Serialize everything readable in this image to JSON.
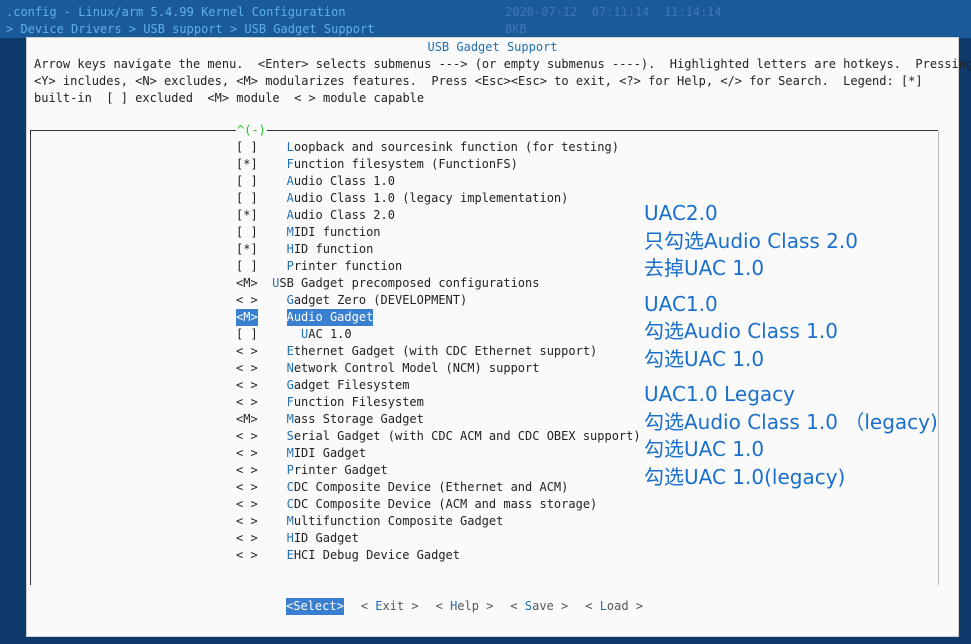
{
  "window": {
    "title_line": ".config - Linux/arm 5.4.99 Kernel Configuration",
    "breadcrumb": "> Device Drivers > USB support > USB Gadget Support",
    "ghost_line1": "2020-07-12  07:11:14  11:14:14",
    "ghost_line2": "8KB"
  },
  "dialog": {
    "title": "USB Gadget Support",
    "help_lines": [
      "Arrow keys navigate the menu.  <Enter> selects submenus ---> (or empty submenus ----).  Highlighted letters are hotkeys.  Pressing",
      "<Y> includes, <N> excludes, <M> modularizes features.  Press <Esc><Esc> to exit, <?> for Help, </> for Search.  Legend: [*]",
      "built-in  [ ] excluded  <M> module  < > module capable"
    ],
    "scroll_indicator": "^(-)"
  },
  "menu": {
    "items": [
      {
        "sel": "[ ]",
        "pad": "    ",
        "hk": "L",
        "rest": "oopback and sourcesink function (for testing)",
        "highlight": false
      },
      {
        "sel": "[*]",
        "pad": "    ",
        "hk": "F",
        "rest": "unction filesystem (FunctionFS)",
        "highlight": false
      },
      {
        "sel": "[ ]",
        "pad": "    ",
        "hk": "A",
        "rest": "udio Class 1.0",
        "highlight": false
      },
      {
        "sel": "[ ]",
        "pad": "    ",
        "hk": "A",
        "rest": "udio Class 1.0 (legacy implementation)",
        "highlight": false
      },
      {
        "sel": "[*]",
        "pad": "    ",
        "hk": "A",
        "rest": "udio Class 2.0",
        "highlight": false
      },
      {
        "sel": "[ ]",
        "pad": "    ",
        "hk": "M",
        "rest": "IDI function",
        "highlight": false
      },
      {
        "sel": "[*]",
        "pad": "    ",
        "hk": "H",
        "rest": "ID function",
        "highlight": false
      },
      {
        "sel": "[ ]",
        "pad": "    ",
        "hk": "P",
        "rest": "rinter function",
        "highlight": false
      },
      {
        "sel": "<M>",
        "pad": "  ",
        "hk": "U",
        "rest": "SB Gadget precomposed configurations",
        "highlight": false
      },
      {
        "sel": "< >",
        "pad": "    ",
        "hk": "G",
        "rest": "adget Zero (DEVELOPMENT)",
        "highlight": false
      },
      {
        "sel": "<M>",
        "pad": "    ",
        "hk": "A",
        "rest": "udio Gadget",
        "highlight": true
      },
      {
        "sel": "[ ]",
        "pad": "      ",
        "hk": "U",
        "rest": "AC 1.0",
        "highlight": false
      },
      {
        "sel": "< >",
        "pad": "    ",
        "hk": "E",
        "rest": "thernet Gadget (with CDC Ethernet support)",
        "highlight": false
      },
      {
        "sel": "< >",
        "pad": "    ",
        "hk": "N",
        "rest": "etwork Control Model (NCM) support",
        "highlight": false
      },
      {
        "sel": "< >",
        "pad": "    ",
        "hk": "G",
        "rest": "adget Filesystem",
        "highlight": false
      },
      {
        "sel": "< >",
        "pad": "    ",
        "hk": "F",
        "rest": "unction Filesystem",
        "highlight": false
      },
      {
        "sel": "<M>",
        "pad": "    ",
        "hk": "M",
        "rest": "ass Storage Gadget",
        "highlight": false
      },
      {
        "sel": "< >",
        "pad": "    ",
        "hk": "S",
        "rest": "erial Gadget (with CDC ACM and CDC OBEX support)",
        "highlight": false
      },
      {
        "sel": "< >",
        "pad": "    ",
        "hk": "M",
        "rest": "IDI Gadget",
        "highlight": false
      },
      {
        "sel": "< >",
        "pad": "    ",
        "hk": "P",
        "rest": "rinter Gadget",
        "highlight": false
      },
      {
        "sel": "< >",
        "pad": "    ",
        "hk": "C",
        "rest": "DC Composite Device (Ethernet and ACM)",
        "highlight": false
      },
      {
        "sel": "< >",
        "pad": "    ",
        "hk": "C",
        "rest": "DC Composite Device (ACM and mass storage)",
        "highlight": false
      },
      {
        "sel": "< >",
        "pad": "    ",
        "hk": "M",
        "rest": "ultifunction Composite Gadget",
        "highlight": false
      },
      {
        "sel": "< >",
        "pad": "    ",
        "hk": "H",
        "rest": "ID Gadget",
        "highlight": false
      },
      {
        "sel": "< >",
        "pad": "    ",
        "hk": "E",
        "rest": "HCI Debug Device Gadget",
        "highlight": false
      }
    ]
  },
  "buttons": [
    {
      "text": "<Select>",
      "hk": "",
      "active": true
    },
    {
      "pre": "< ",
      "hk": "E",
      "rest": "xit >",
      "active": false
    },
    {
      "pre": "< ",
      "hk": "H",
      "rest": "elp >",
      "active": false
    },
    {
      "pre": "< ",
      "hk": "S",
      "rest": "ave >",
      "active": false
    },
    {
      "pre": "< ",
      "hk": "L",
      "rest": "oad >",
      "active": false
    }
  ],
  "notes": {
    "groups": [
      [
        "UAC2.0",
        "只勾选Audio Class 2.0",
        "去掉UAC 1.0"
      ],
      [
        "UAC1.0",
        "勾选Audio Class 1.0",
        "勾选UAC 1.0"
      ],
      [
        "UAC1.0 Legacy",
        "勾选Audio Class 1.0 （legacy)",
        "勾选UAC 1.0",
        "勾选UAC 1.0(legacy)"
      ]
    ]
  },
  "colors": {
    "accent": "#3a7fd0",
    "hotkey": "#1f6fb2",
    "note_text": "#1a6fcb",
    "scroll_indicator": "#22c522"
  }
}
